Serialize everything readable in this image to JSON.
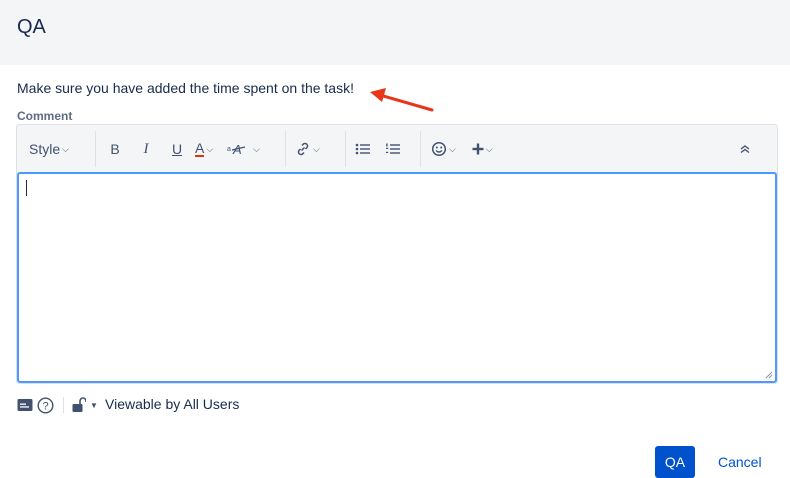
{
  "dialog": {
    "title": "QA"
  },
  "message": "Make sure you have added the time spent on the task!",
  "comment": {
    "label": "Comment",
    "value": "",
    "toolbar": {
      "style_label": "Style",
      "bold": "B",
      "italic": "I",
      "underline": "U",
      "text_color": "A",
      "text_color_accent": "#de350b",
      "icons": [
        "chevron-down-icon",
        "link-icon",
        "bullet-list-icon",
        "numbered-list-icon",
        "emoji-icon",
        "plus-icon",
        "collapse-icon"
      ]
    }
  },
  "visibility": {
    "label": "Viewable by All Users"
  },
  "buttons": {
    "submit": "QA",
    "cancel": "Cancel"
  },
  "colors": {
    "primary": "#0052cc",
    "focus_border": "#4c9aff",
    "annotation_arrow": "#e8361b"
  }
}
